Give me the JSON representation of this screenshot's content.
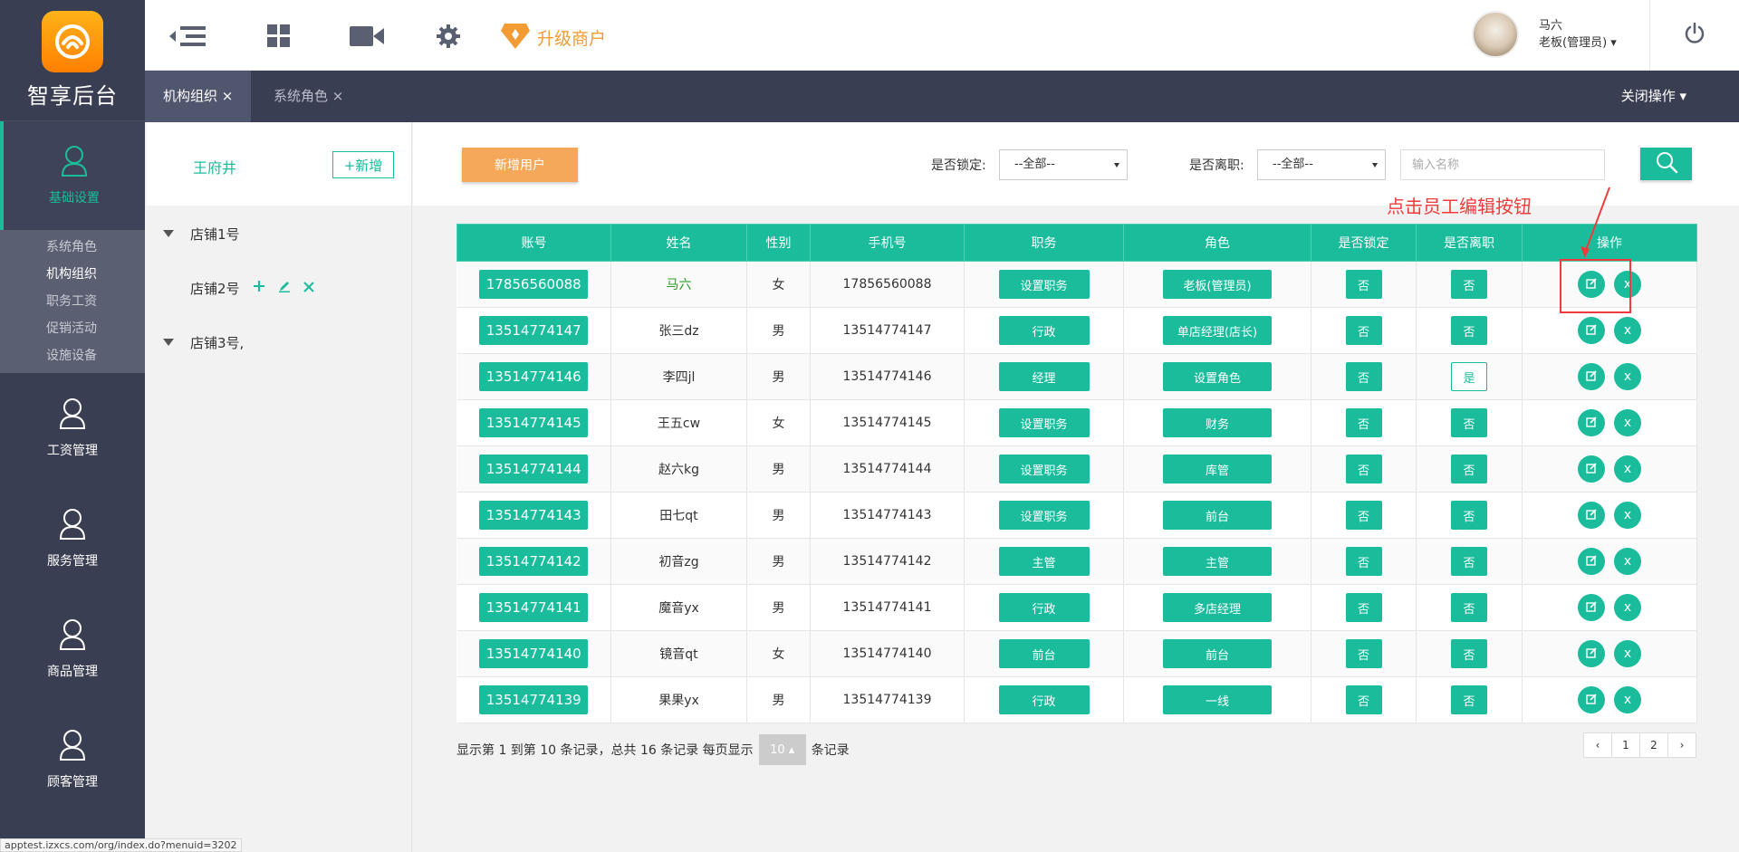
{
  "app": {
    "logo_text": "智享后台"
  },
  "sidebar": {
    "active_item": {
      "label": "基础设置"
    },
    "submenu": [
      "系统角色",
      "机构组织",
      "职务工资",
      "促销活动",
      "设施设备"
    ],
    "groups": [
      {
        "label": "工资管理"
      },
      {
        "label": "服务管理"
      },
      {
        "label": "商品管理"
      },
      {
        "label": "顾客管理"
      }
    ]
  },
  "topbar": {
    "upgrade_label": "升级商户",
    "user_name": "马六",
    "user_role": "老板(管理员)",
    "user_caret": "▾"
  },
  "tabs": {
    "items": [
      {
        "label": "机构组织 ×"
      },
      {
        "label": "系统角色 ×"
      }
    ],
    "close_ops": "关闭操作 ▾"
  },
  "tree": {
    "org_name": "王府井",
    "add_button": "+新增",
    "stores": [
      {
        "label": "店铺1号"
      },
      {
        "label": "店铺2号"
      },
      {
        "label": "店铺3号,"
      }
    ]
  },
  "filters": {
    "new_user_button": "新增用户",
    "locked_label": "是否锁定:",
    "locked_value": "--全部--",
    "resigned_label": "是否离职:",
    "resigned_value": "--全部--",
    "name_placeholder": "输入名称"
  },
  "annotation": {
    "text": "点击员工编辑按钮"
  },
  "table": {
    "headers": [
      "账号",
      "姓名",
      "性别",
      "手机号",
      "职务",
      "角色",
      "是否锁定",
      "是否离职",
      "操作"
    ],
    "edit_icon": "edit-icon",
    "delete_label": "x",
    "rows": [
      {
        "account": "17856560088",
        "name": "马六",
        "gender": "女",
        "phone": "17856560088",
        "position": "设置职务",
        "role": "老板(管理员)",
        "locked": "否",
        "resigned": "否"
      },
      {
        "account": "13514774147",
        "name": "张三dz",
        "gender": "男",
        "phone": "13514774147",
        "position": "行政",
        "role": "单店经理(店长)",
        "locked": "否",
        "resigned": "否"
      },
      {
        "account": "13514774146",
        "name": "李四jl",
        "gender": "男",
        "phone": "13514774146",
        "position": "经理",
        "role": "设置角色",
        "locked": "否",
        "resigned": "是"
      },
      {
        "account": "13514774145",
        "name": "王五cw",
        "gender": "女",
        "phone": "13514774145",
        "position": "设置职务",
        "role": "财务",
        "locked": "否",
        "resigned": "否"
      },
      {
        "account": "13514774144",
        "name": "赵六kg",
        "gender": "男",
        "phone": "13514774144",
        "position": "设置职务",
        "role": "库管",
        "locked": "否",
        "resigned": "否"
      },
      {
        "account": "13514774143",
        "name": "田七qt",
        "gender": "男",
        "phone": "13514774143",
        "position": "设置职务",
        "role": "前台",
        "locked": "否",
        "resigned": "否"
      },
      {
        "account": "13514774142",
        "name": "初音zg",
        "gender": "男",
        "phone": "13514774142",
        "position": "主管",
        "role": "主管",
        "locked": "否",
        "resigned": "否"
      },
      {
        "account": "13514774141",
        "name": "魔音yx",
        "gender": "男",
        "phone": "13514774141",
        "position": "行政",
        "role": "多店经理",
        "locked": "否",
        "resigned": "否"
      },
      {
        "account": "13514774140",
        "name": "镜音qt",
        "gender": "女",
        "phone": "13514774140",
        "position": "前台",
        "role": "前台",
        "locked": "否",
        "resigned": "否"
      },
      {
        "account": "13514774139",
        "name": "果果yx",
        "gender": "男",
        "phone": "13514774139",
        "position": "行政",
        "role": "一线",
        "locked": "否",
        "resigned": "否"
      }
    ]
  },
  "pager": {
    "info": "显示第 1 到第 10 条记录，总共 16 条记录 每页显示",
    "page_size": "10 ▴",
    "suffix": "条记录",
    "pages": [
      "‹",
      "1",
      "2",
      "›"
    ]
  },
  "status_url": "apptest.izxcs.com/org/index.do?menuid=3202",
  "colors": {
    "accent": "#1abc9c",
    "sidebar": "#3a3e52",
    "orange": "#f5a85a",
    "annotation": "#ee3b3b"
  }
}
